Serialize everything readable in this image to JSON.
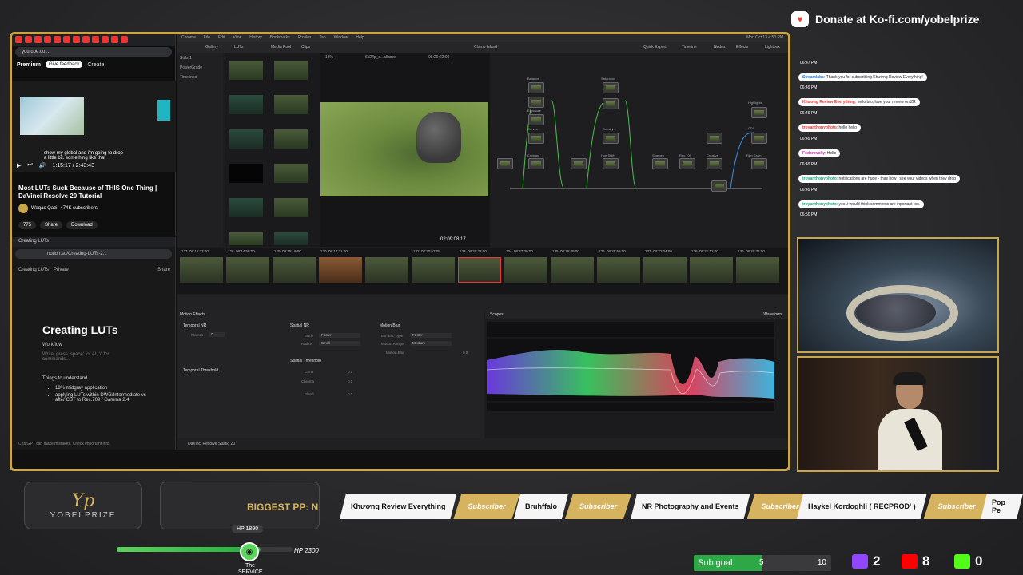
{
  "donate": {
    "text": "Donate at Ko-fi.com/yobelprize"
  },
  "youtube": {
    "address": "youtube.co...",
    "logo": "Premium",
    "feedback": "Give feedback",
    "create": "Create",
    "caption_line1": "show my global and i'm going to drop",
    "caption_line2": "a little bit. something like that",
    "time": "1:15:17 / 2:43:43",
    "video_title": "Most LUTs Suck Because of THIS One Thing | DaVinci Resolve 20 Tutorial",
    "channel": "Waqas Qazi",
    "subscribers": "474K subscribers",
    "likes": "775",
    "share": "Share",
    "download": "Download"
  },
  "notion": {
    "tab": "Creating LUTs",
    "address": "notion.so/Creating-LUTs-2...",
    "crumb_page": "Creating LUTs",
    "crumb_private": "Private",
    "crumb_share": "Share",
    "title": "Creating LUTs",
    "workflow": "Workflow",
    "placeholder": "Write, press 'space' for AI, '/' for commands...",
    "things": "Things to understand",
    "bullets": [
      "18% midgray application",
      "applying LUTs within DWG/Intermediate vs after CST to Rec.709 / Gamma 2.4"
    ],
    "footer": "ChatGPT can make mistakes. Check important info."
  },
  "resolve": {
    "menu": [
      "Chrome",
      "File",
      "Edit",
      "View",
      "History",
      "Bookmarks",
      "Profiles",
      "Tab",
      "Window",
      "Help"
    ],
    "clock": "Mon Oct 13  4:50 PM",
    "toolbar": {
      "gallery": "Gallery",
      "luts": "LUTs",
      "media_pool": "Media Pool",
      "clips": "Clips",
      "project": "Chimp Island",
      "quick_export": "Quick Export",
      "timeline": "Timeline",
      "nodes": "Nodes",
      "effects": "Effects",
      "lightbox": "Lightbox",
      "zoom": "18%",
      "clip_name": "6k24p_c...aliased",
      "timecode": "08:29:22:00",
      "clip": "Clip"
    },
    "gallery_items": [
      "Stills 1",
      "PowerGrade",
      "Timelines"
    ],
    "viewer_tc": "02:09:08:17",
    "nodes": {
      "balance": "Balance",
      "exposure": "Exposure",
      "contrast": "Contrast",
      "curves": "Curves",
      "saturation": "Saturation",
      "hue_shift": "Hue Shift",
      "density": "Density",
      "sharpen": "Sharpen",
      "rec709": "Rec.709",
      "creative": "Creative",
      "film_grain": "Film Grain",
      "highlights": "Highlights",
      "cdl": "CDL"
    },
    "strip_tcs": [
      "08:16:27:00",
      "08:14:58:00",
      "08:15:19:00",
      "08:14:31:00",
      "08:30:52:08",
      "08:29:22:00",
      "08:27:30:00",
      "08:26:49:00",
      "08:25:55:00",
      "08:22:34:00",
      "08:21:12:00",
      "08:20:31:00"
    ],
    "strip_nums": [
      "127",
      "128",
      "129",
      "130",
      "131",
      "132",
      "133",
      "134",
      "135",
      "136",
      "137",
      "138",
      "139",
      "140"
    ],
    "motion": {
      "title": "Motion Effects",
      "temporal_nr": "Temporal NR",
      "frames": "Frames",
      "frames_val": "0",
      "mo_est": "Mo. Est. Type",
      "mo_est_val": "Faster",
      "motion_range": "Motion Range",
      "motion_range_val": "Medium",
      "temporal_threshold": "Temporal Threshold",
      "luma": "Luma",
      "chroma": "Chroma",
      "motion": "Motion",
      "blend": "Blend",
      "spatial_nr": "Spatial NR",
      "mode": "Mode",
      "mode_val": "Faster",
      "radius": "Radius",
      "radius_val": "Small",
      "spatial_threshold": "Spatial Threshold",
      "zero": "0.0",
      "motion_blur": "Motion Blur",
      "mb_mo_est_val": "Faster",
      "mb_range_val": "Medium",
      "mb_label": "Motion Blur",
      "mb_val": "0.0"
    },
    "scopes": {
      "title": "Scopes",
      "type": "Waveform"
    },
    "app_name": "DaVinci Resolve Studio 20"
  },
  "chat": {
    "messages": [
      {
        "ts": "06:47 PM",
        "user": "",
        "text": ""
      },
      {
        "ts": "",
        "user": "Streamlabs",
        "text": ": Thank you for subscribing Khương Review Everything!"
      },
      {
        "ts": "06:49 PM",
        "user": "Khương Review Everything",
        "text": ": hello bro, love your review on ZR"
      },
      {
        "ts": "06:49 PM",
        "user": "troyanthonyphoto",
        "text": ": hello hello"
      },
      {
        "ts": "06:49 PM",
        "user": "Fedorovsky",
        "text": ": Hello"
      },
      {
        "ts": "06:49 PM",
        "user": "troyanthonyphoto",
        "text": ": notifications are huge - thas how i see your videos when they drop"
      },
      {
        "ts": "06:49 PM",
        "user": "troyanthonyphoto",
        "text": ": yes .i would think comments are inportant too."
      },
      {
        "ts": "06:50 PM",
        "user": "",
        "text": ""
      }
    ]
  },
  "bottom": {
    "logo_mark": "Yp",
    "logo_name": "YOBELPRIZE",
    "pp_label": "BIGGEST PP: N",
    "subs": [
      {
        "name": "Khương Review Everything",
        "badge": "Subscriber"
      },
      {
        "name": "Bruhffalo",
        "badge": "Subscriber"
      },
      {
        "name": "NR Photography and Events",
        "badge": "Subscriber"
      },
      {
        "name": "Haykel Kordoghli ( RECPROD' )",
        "badge": "Subscriber"
      },
      {
        "name": "Pop Pe",
        "badge": ""
      }
    ],
    "hp_current": "HP 1890",
    "hp_max": "HP 2300",
    "hp_fraction": 0.82,
    "boss_name": "The SERVICE",
    "sub_goal_label": "Sub goal",
    "sub_goal_current": "5",
    "sub_goal_target": "10",
    "twitch_count": "2",
    "youtube_count": "8",
    "kick_count": "0",
    "colors": {
      "gold": "#c9a64a",
      "twitch": "#9146ff",
      "youtube": "#ff0000",
      "kick": "#53fc18",
      "goal_green": "#2ea846"
    }
  }
}
